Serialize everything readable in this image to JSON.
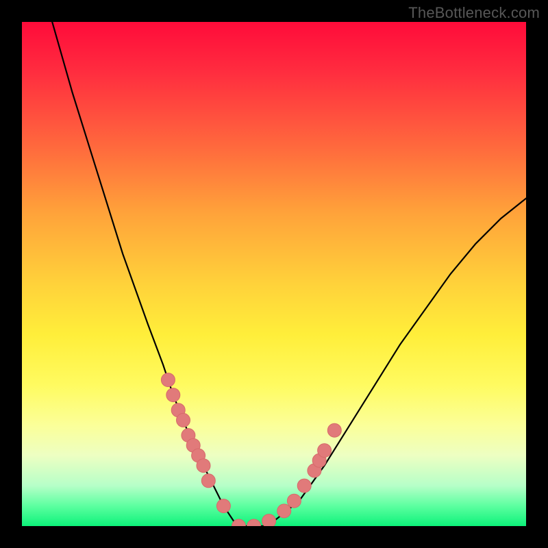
{
  "watermark": "TheBottleneck.com",
  "chart_data": {
    "type": "line",
    "title": "",
    "xlabel": "",
    "ylabel": "",
    "xlim": [
      0,
      100
    ],
    "ylim": [
      0,
      100
    ],
    "series": [
      {
        "name": "bottleneck-curve",
        "x": [
          6,
          10,
          15,
          20,
          25,
          28,
          30,
          32,
          34,
          36,
          38,
          40,
          42,
          44,
          46,
          48,
          50,
          55,
          60,
          65,
          70,
          75,
          80,
          85,
          90,
          95,
          100
        ],
        "y": [
          100,
          86,
          70,
          54,
          40,
          32,
          26,
          21,
          16,
          12,
          8,
          4,
          1,
          0,
          0,
          0,
          1,
          5,
          12,
          20,
          28,
          36,
          43,
          50,
          56,
          61,
          65
        ]
      }
    ],
    "markers": {
      "name": "highlight-points",
      "x": [
        29,
        30,
        31,
        32,
        33,
        34,
        35,
        36,
        37,
        40,
        43,
        46,
        49,
        52,
        54,
        56,
        58,
        59,
        60,
        62
      ],
      "y": [
        29,
        26,
        23,
        21,
        18,
        16,
        14,
        12,
        9,
        4,
        0,
        0,
        1,
        3,
        5,
        8,
        11,
        13,
        15,
        19
      ]
    },
    "background": {
      "type": "vertical-gradient",
      "stops": [
        {
          "pos": 0.0,
          "color": "#ff0b3a"
        },
        {
          "pos": 0.25,
          "color": "#ff6a3d"
        },
        {
          "pos": 0.52,
          "color": "#ffd23a"
        },
        {
          "pos": 0.8,
          "color": "#fbff99"
        },
        {
          "pos": 1.0,
          "color": "#0df27a"
        }
      ]
    },
    "colors": {
      "curve": "#000000",
      "marker_fill": "#e17a7a",
      "marker_stroke": "#d66a6a",
      "frame": "#000000",
      "watermark": "#575757"
    }
  }
}
